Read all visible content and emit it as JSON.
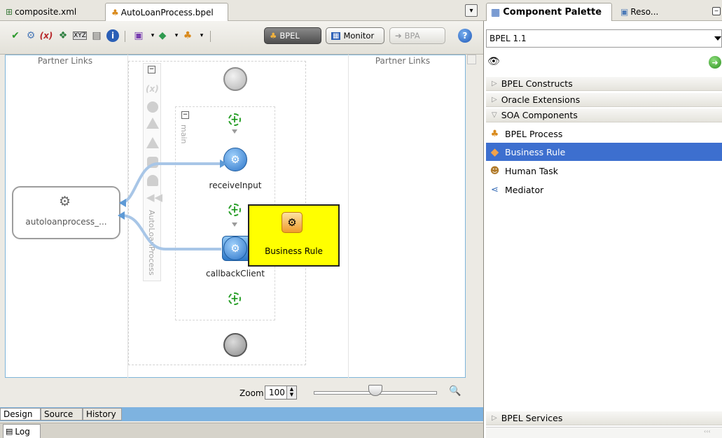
{
  "editor": {
    "tabs": [
      {
        "label": "composite.xml",
        "icon": "composite-icon"
      },
      {
        "label": "AutoLoanProcess.bpel",
        "icon": "bpel-process-icon"
      }
    ],
    "toolbar": {
      "icons": [
        "validate-check-icon",
        "settings-gear-icon",
        "variables-icon",
        "properties-icon",
        "xml-icon",
        "schema-icon",
        "info-icon",
        "outline-icon",
        "deploy-icon",
        "run-icon"
      ],
      "mode_buttons": [
        {
          "label": "BPEL",
          "state": "active"
        },
        {
          "label": "Monitor",
          "state": "normal"
        },
        {
          "label": "BPA",
          "state": "disabled"
        }
      ],
      "help": "?"
    },
    "canvas": {
      "partner_links_left": "Partner Links",
      "partner_links_right": "Partner Links",
      "partner_link_name": "autoloanprocess_...",
      "scope_label": "AutoLoanProcess",
      "sequence_label": "main",
      "activities": {
        "receive": "receiveInput",
        "callback": "callbackClient"
      },
      "tooltip": "Business Rule"
    },
    "zoom": {
      "label": "Zoom:",
      "value": "100",
      "slider_fraction": 0.5
    },
    "bottom_tabs": [
      "Design",
      "Source",
      "History"
    ],
    "log_tab": "Log"
  },
  "palette": {
    "title": "Component Palette",
    "other_tab": "Reso...",
    "selected": "BPEL 1.1",
    "sections": {
      "constructs": "BPEL Constructs",
      "oracle_ext": "Oracle Extensions",
      "soa": "SOA Components",
      "services": "BPEL Services"
    },
    "soa_items": [
      {
        "label": "BPEL Process",
        "icon": "bpel-process-icon",
        "selected": false
      },
      {
        "label": "Business Rule",
        "icon": "business-rule-icon",
        "selected": true
      },
      {
        "label": "Human Task",
        "icon": "human-task-icon",
        "selected": false
      },
      {
        "label": "Mediator",
        "icon": "mediator-icon",
        "selected": false
      }
    ],
    "colors": {
      "selection": "#3d6fcf",
      "tooltip": "#ffff00",
      "canvas_border": "#7fb5d9"
    }
  }
}
